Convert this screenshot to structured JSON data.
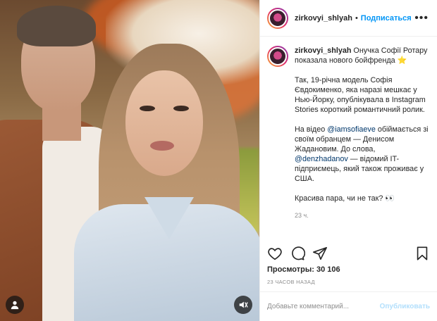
{
  "media": {
    "user_icon": "user-tag-icon",
    "mute_icon": "sound-icon"
  },
  "header": {
    "username": "zirkovyi_shlyah",
    "separator": "•",
    "follow_label": "Подписаться",
    "more_icon": "more-options-icon"
  },
  "caption": {
    "username": "zirkovyi_shlyah",
    "title": "Онучка Софії Ротару показала нового бойфренда",
    "star": "⭐",
    "para1": "Так, 19-річна модель Софія Євдокименко, яка наразі мешкає у Нью-Йорку, опублікувала в Instagram Stories короткий романтичний ролик.",
    "para2_pre": "На відео ",
    "para2_mention1": "@iamsofiaeve",
    "para2_mid": " обіймається зі своїм обранцем — Денисом Жадановим. До слова, ",
    "para2_mention2": "@denzhadanov",
    "para2_post": " — відомий IT-підприємець, який також проживає у США.",
    "para3": "Красива пара, чи не так?",
    "eyes": "👀",
    "time": "23 ч."
  },
  "actions": {
    "like_icon": "heart-icon",
    "comment_icon": "comment-icon",
    "share_icon": "share-icon",
    "save_icon": "bookmark-icon"
  },
  "stats": {
    "views_label": "Просмотры:",
    "views_value": "30 106",
    "posted": "23 часов назад"
  },
  "comment": {
    "placeholder": "Добавьте комментарий...",
    "publish_label": "Опубликовать"
  }
}
